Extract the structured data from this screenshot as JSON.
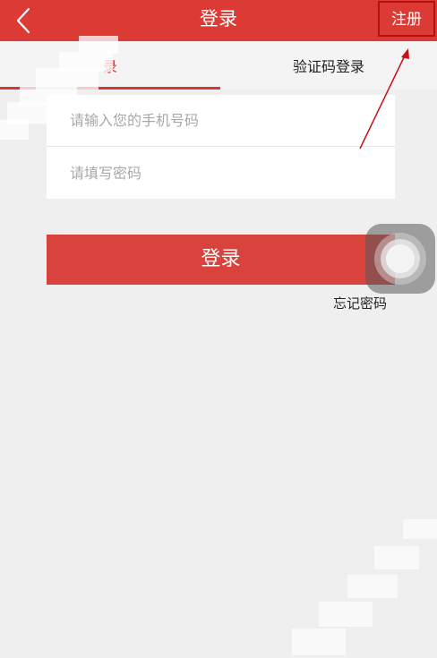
{
  "header": {
    "title": "登录",
    "register_label": "注册"
  },
  "tabs": [
    {
      "label": "录",
      "active": true
    },
    {
      "label": "验证码登录",
      "active": false
    }
  ],
  "form": {
    "phone_placeholder": "请输入您的手机号码",
    "password_placeholder": "请填写密码",
    "login_label": "登录",
    "forgot_label": "忘记密码"
  },
  "colors": {
    "header_bg": "#dc3a34",
    "accent": "#d23a34",
    "login_button": "#d9433d",
    "annotation": "#c8101a"
  },
  "icons": {
    "back": "chevron-left-icon",
    "assistive": "assistive-touch-icon"
  }
}
